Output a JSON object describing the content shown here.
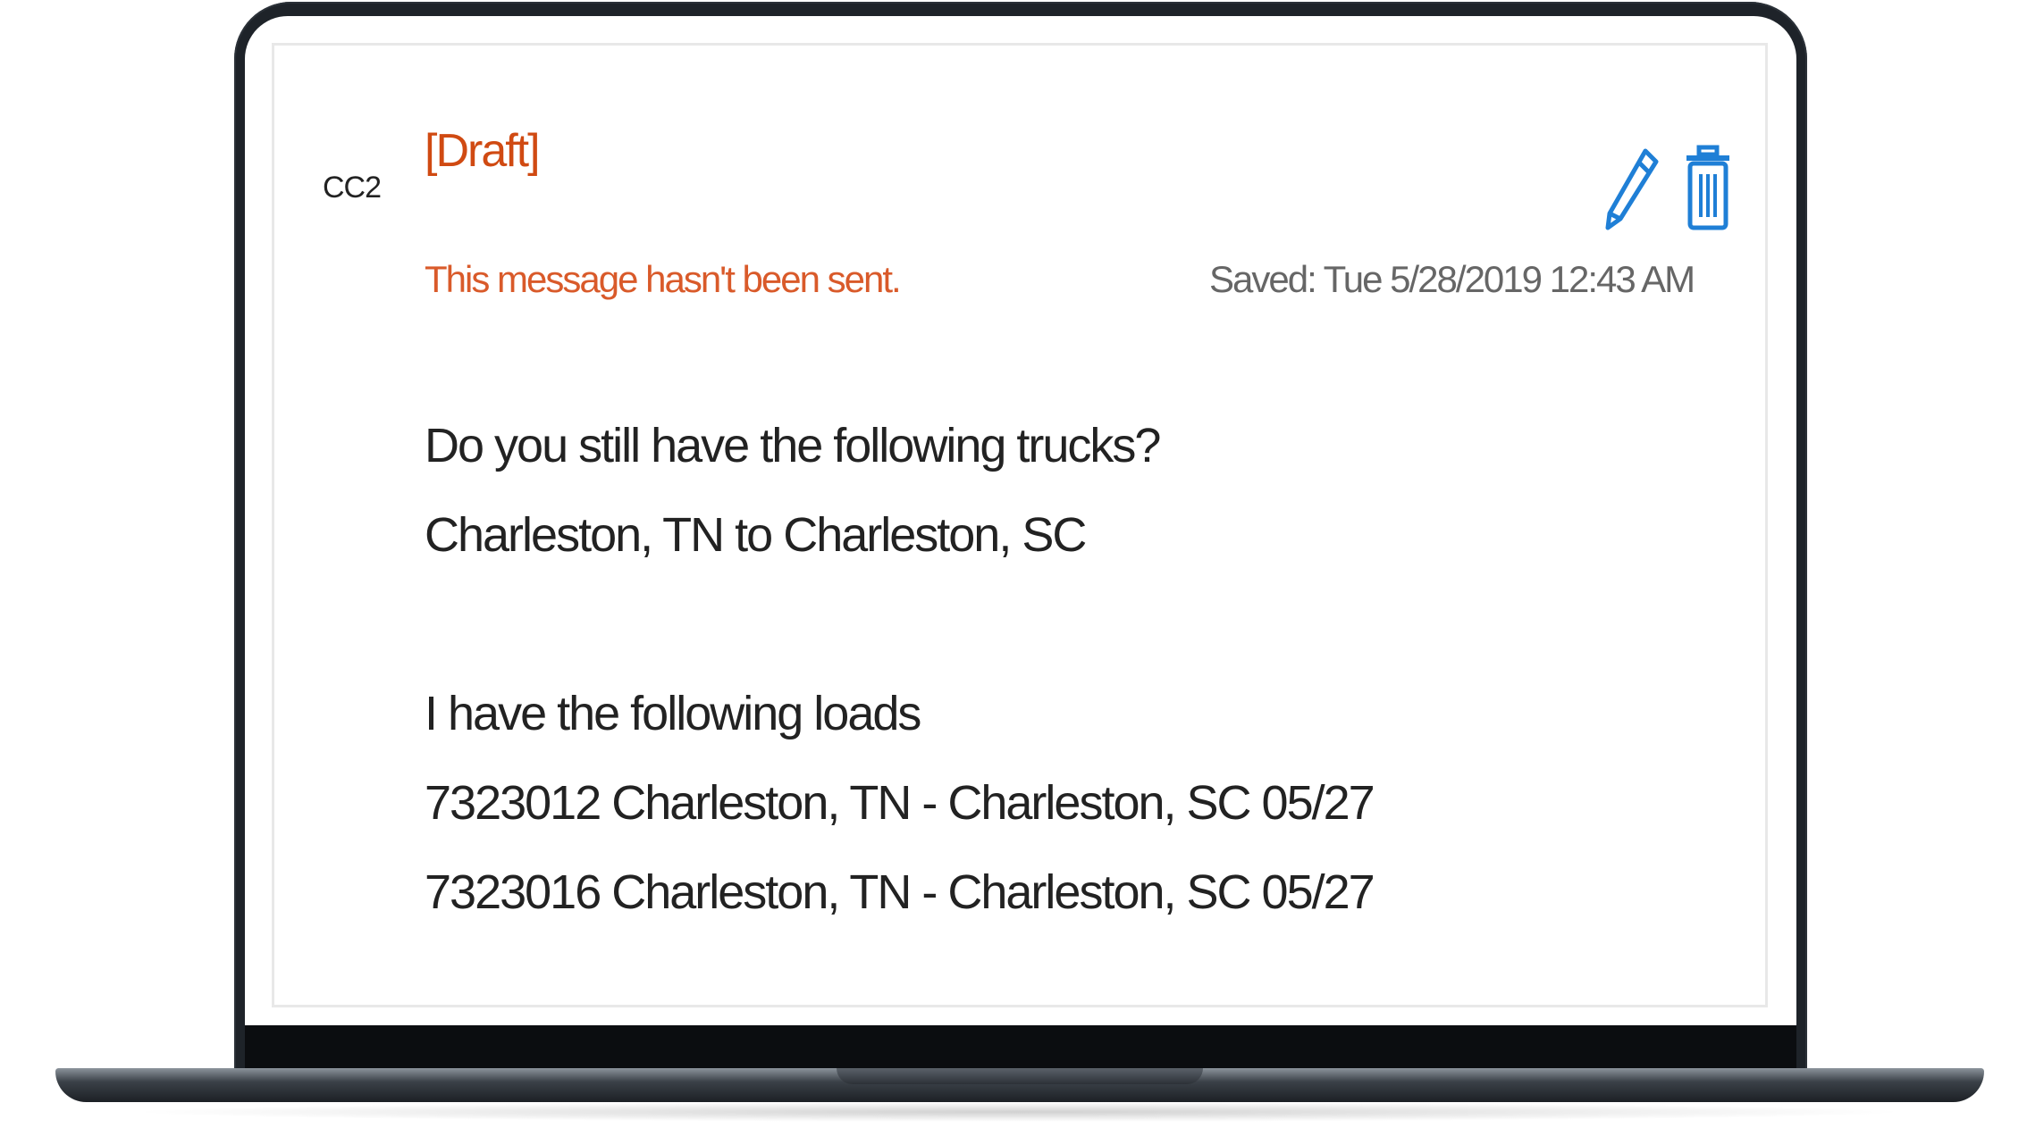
{
  "message": {
    "sender": "CC2",
    "draft_label": "[Draft]",
    "status_text": "This message hasn't been sent.",
    "saved_text": "Saved: Tue 5/28/2019 12:43 AM",
    "body_lines": [
      "Do you still have the following trucks?",
      "Charleston, TN to Charleston, SC",
      "",
      "I have the following loads",
      "7323012 Charleston, TN - Charleston, SC 05/27",
      "7323016 Charleston, TN - Charleston, SC 05/27"
    ]
  },
  "actions": {
    "edit_icon": "pencil-icon",
    "delete_icon": "trash-icon"
  },
  "colors": {
    "draft_accent": "#d04a12",
    "icon_accent": "#1f7fd6",
    "bezel": "#1e2329"
  }
}
